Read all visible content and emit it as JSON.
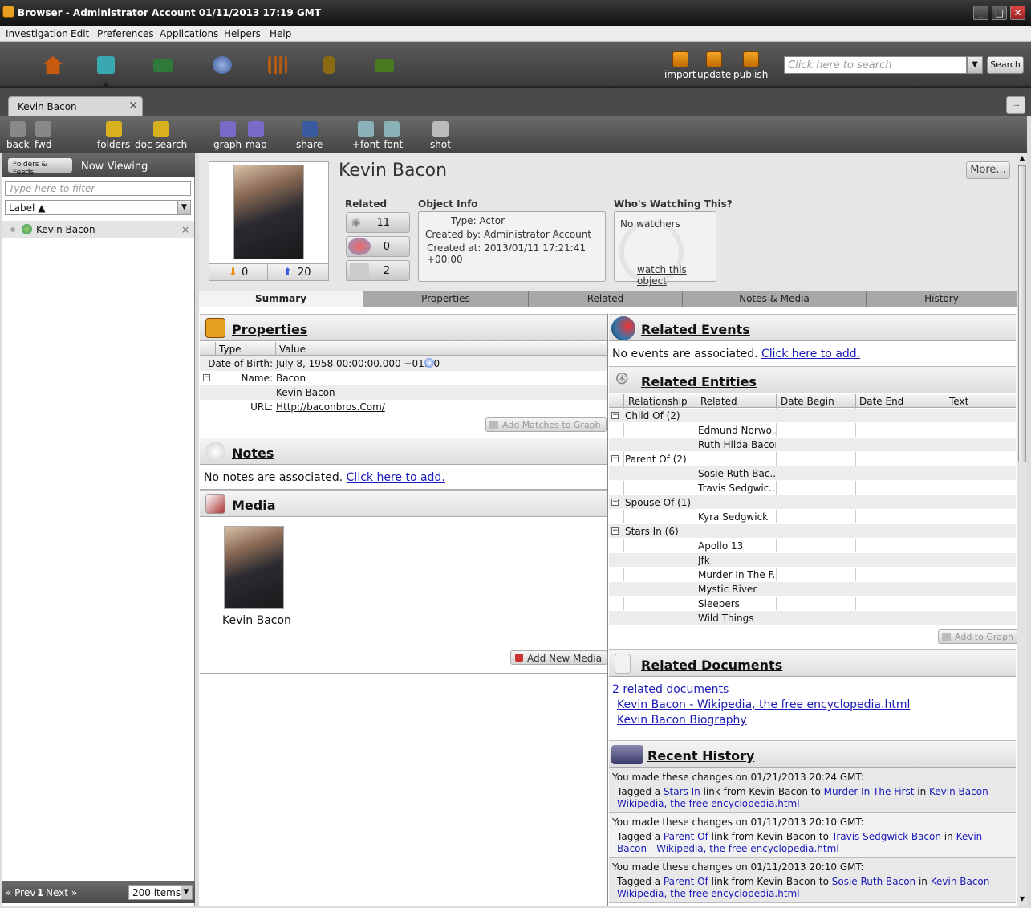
{
  "window": {
    "title": "Browser - Administrator Account 01/11/2013 17:19 GMT"
  },
  "menu": [
    "Investigation",
    "Edit",
    "Preferences",
    "Applications",
    "Helpers",
    "Help"
  ],
  "nav_icons": [
    "home-icon",
    "documents-icon",
    "entities-icon",
    "globe-icon",
    "charts-icon",
    "database-icon",
    "camera-icon"
  ],
  "publish_bar": {
    "import": "import",
    "update": "update",
    "publish": "publish"
  },
  "search": {
    "placeholder": "Click here to search",
    "button": "Search"
  },
  "doc_tab": {
    "label": "Kevin Bacon",
    "more": "..."
  },
  "toolbar": {
    "back": "back",
    "fwd": "fwd",
    "folders": "folders",
    "doc_search": "doc search",
    "graph": "graph",
    "map": "map",
    "share": "share",
    "font_up": "+font",
    "font_down": "-font",
    "shot": "shot"
  },
  "sidebar": {
    "folders_btn": "Folders & Feeds",
    "heading": "Now Viewing",
    "filter_placeholder": "Type here to filter",
    "sort_label": "Label ▲",
    "items": [
      {
        "label": "Kevin Bacon",
        "close": "×"
      }
    ],
    "footer": {
      "prev": "« Prev",
      "page": "1",
      "next": "Next »",
      "items": "200 items"
    }
  },
  "object": {
    "title": "Kevin Bacon",
    "more": "More...",
    "votes_down": "0",
    "votes_up": "20",
    "related_label": "Related",
    "related_counts": [
      "11",
      "0",
      "2"
    ],
    "info_label": "Object Info",
    "type": "Type: Actor",
    "created_by": "Created by: Administrator Account",
    "created_at": "Created at: 2013/01/11 17:21:41 +00:00",
    "watch_label": "Who's Watching This?",
    "no_watchers": "No watchers",
    "watch_link": "watch this object"
  },
  "tabs": [
    "Summary",
    "Properties",
    "Related",
    "Notes & Media",
    "History"
  ],
  "properties": {
    "title": "Properties",
    "col_type": "Type",
    "col_value": "Value",
    "rows": [
      {
        "k": "Date of Birth:",
        "v": "July 8, 1958 00:00:00.000 +01:00"
      },
      {
        "k": "Name:",
        "v": "Bacon"
      },
      {
        "k": "",
        "v": "Kevin Bacon"
      },
      {
        "k": "URL:",
        "v": "Http://baconbros.Com/"
      }
    ],
    "add_btn": "Add Matches to Graph"
  },
  "notes": {
    "title": "Notes",
    "empty": "No notes are associated.",
    "add": "Click here to add."
  },
  "media": {
    "title": "Media",
    "caption": "Kevin Bacon",
    "add": "Add New Media"
  },
  "events": {
    "title": "Related Events",
    "empty": "No events are associated.",
    "add": "Click here to add."
  },
  "entities": {
    "title": "Related Entities",
    "cols": [
      "Relationship",
      "Related",
      "Date Begin",
      "Date End",
      "Text"
    ],
    "groups": [
      {
        "label": "Child Of (2)",
        "items": [
          "Edmund Norwo...",
          "Ruth Hilda Bacon"
        ]
      },
      {
        "label": "Parent Of (2)",
        "items": [
          "Sosie Ruth Bac...",
          "Travis Sedgwic..."
        ]
      },
      {
        "label": "Spouse Of (1)",
        "items": [
          "Kyra Sedgwick"
        ]
      },
      {
        "label": "Stars In (6)",
        "items": [
          "Apollo 13",
          "Jfk",
          "Murder In The F...",
          "Mystic River",
          "Sleepers",
          "Wild Things"
        ]
      }
    ],
    "add_btn": "Add to Graph"
  },
  "documents": {
    "title": "Related Documents",
    "count_link": "2 related documents",
    "links": [
      "Kevin Bacon - Wikipedia, the free encyclopedia.html",
      "Kevin Bacon Biography"
    ]
  },
  "history": {
    "title": "Recent History",
    "entries": [
      {
        "head": "You made these changes on 01/21/2013 20:24 GMT:",
        "pre": "Tagged a ",
        "link1": "Stars In",
        "mid": " link from Kevin Bacon to ",
        "link2": "Murder In The First",
        "in": " in ",
        "link3a": "Kevin Bacon - Wikipedia,",
        "link3b": "the free encyclopedia.html"
      },
      {
        "head": "You made these changes on 01/11/2013 20:10 GMT:",
        "pre": "Tagged a ",
        "link1": "Parent Of",
        "mid": " link from Kevin Bacon to ",
        "link2": "Travis Sedgwick Bacon",
        "in": " in ",
        "link3a": "Kevin Bacon -",
        "link3b": "Wikipedia, the free encyclopedia.html"
      },
      {
        "head": "You made these changes on 01/11/2013 20:10 GMT:",
        "pre": "Tagged a ",
        "link1": "Parent Of",
        "mid": " link from Kevin Bacon to ",
        "link2": "Sosie Ruth Bacon",
        "in": " in ",
        "link3a": "Kevin Bacon - Wikipedia,",
        "link3b": "the free encyclopedia.html"
      }
    ]
  }
}
